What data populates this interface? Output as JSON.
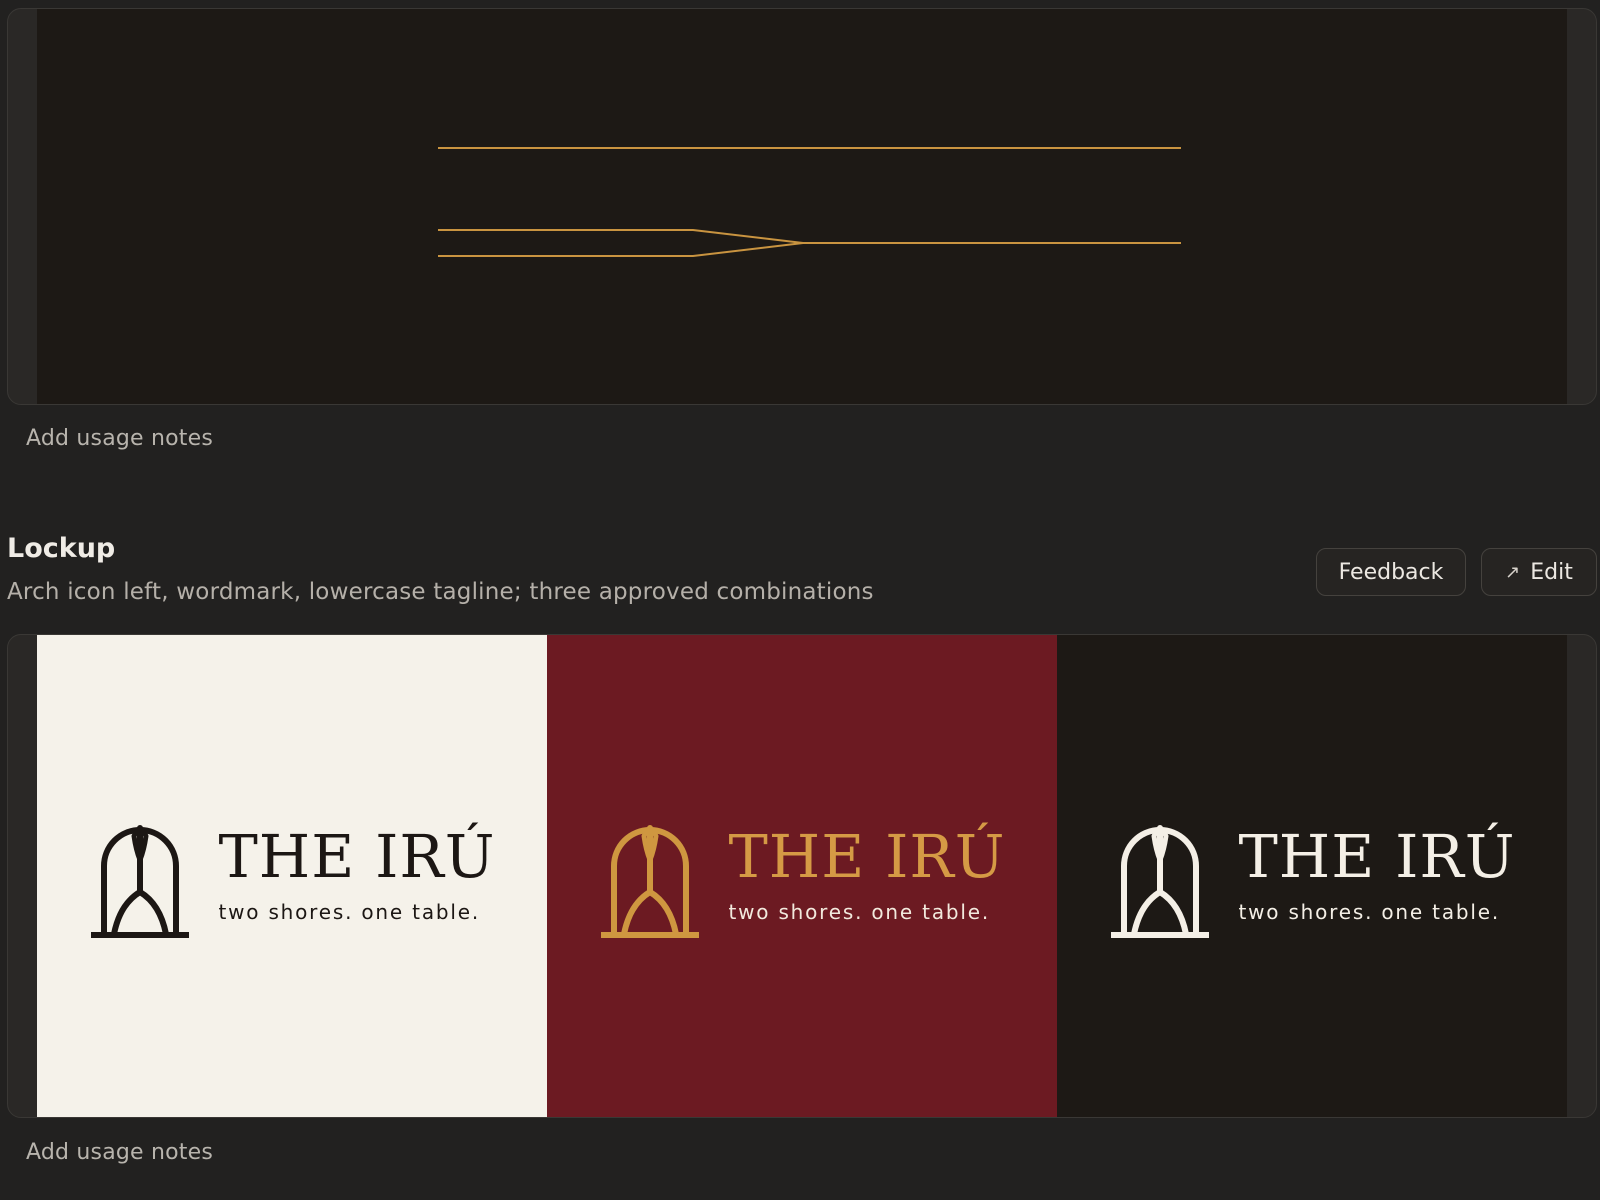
{
  "top_section": {
    "usage_notes": "Add usage notes"
  },
  "lockup_section": {
    "title": "Lockup",
    "description": "Arch icon left, wordmark, lowercase tagline; three approved combinations",
    "feedback_label": "Feedback",
    "edit_label": "Edit",
    "edit_icon": "arrow-up-right-icon",
    "usage_notes": "Add usage notes",
    "variants": [
      {
        "background": "#f5f2ea",
        "icon_color": "#1c1714",
        "wordmark_color": "#1c1714",
        "tagline_color": "#1c1714",
        "wordmark": "THE IRÚ",
        "tagline": "two shores. one table."
      },
      {
        "background": "#6c1a22",
        "icon_color": "#cf9740",
        "wordmark_color": "#d59a45",
        "tagline_color": "#f2e9dd",
        "wordmark": "THE IRÚ",
        "tagline": "two shores. one table."
      },
      {
        "background": "#1d1915",
        "icon_color": "#f4efe6",
        "wordmark_color": "#f4efe6",
        "tagline_color": "#f4efe6",
        "wordmark": "THE IRÚ",
        "tagline": "two shores. one table."
      }
    ]
  },
  "colors": {
    "page_background": "#222120",
    "gold_line": "#c99440",
    "dark_canvas": "#1d1915"
  }
}
